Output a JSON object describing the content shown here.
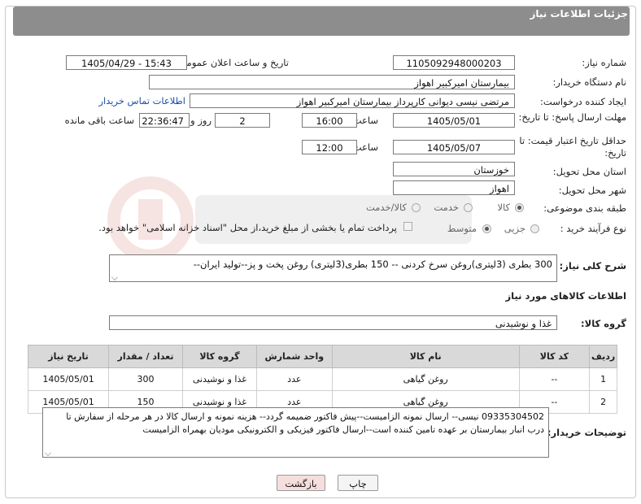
{
  "header": {
    "title": "جزئیات اطلاعات نیاز"
  },
  "fields": {
    "need_number_label": "شماره نیاز:",
    "need_number": "1105092948000203",
    "announce_label": "تاریخ و ساعت اعلان عمومی:",
    "announce_value": "1405/04/29 - 15:43",
    "buyer_org_label": "نام دستگاه خریدار:",
    "buyer_org": "بیمارستان امیرکبیر اهواز",
    "creator_label": "ایجاد کننده درخواست:",
    "creator": "مرتضی نیسی دیوانی کارپرداز بیمارستان امیرکبیر اهواز",
    "contact_link": "اطلاعات تماس خریدار",
    "reply_deadline_label": "مهلت ارسال پاسخ: تا تاریخ:",
    "reply_date": "1405/05/01",
    "time_label": "ساعت",
    "reply_time": "16:00",
    "days_value": "2",
    "days_label": "روز و",
    "remaining_time": "22:36:47",
    "remaining_label": "ساعت باقی مانده",
    "price_deadline_label": "حداقل تاریخ اعتبار قیمت: تا تاریخ:",
    "price_date": "1405/05/07",
    "price_time_label": "ساعت",
    "price_time": "12:00",
    "province_label": "استان محل تحویل:",
    "province": "خوزستان",
    "city_label": "شهر محل تحویل:",
    "city": "اهواز",
    "category_label": "طبقه بندی موضوعی:",
    "category_options": [
      "کالا",
      "خدمت",
      "کالا/خدمت"
    ],
    "process_label": "نوع فرآیند خرید :",
    "process_options": [
      "جزیی",
      "متوسط"
    ],
    "payment_note": "پرداخت تمام یا بخشی از مبلغ خرید،از محل \"اسناد خزانه اسلامی\" خواهد بود."
  },
  "description": {
    "label": "شرح کلی نیاز:",
    "text": "300 بطری (3لیتری)روغن سرخ کردنی -- 150 بطری(3لیتری) روغن پخت و پز--تولید ایران--"
  },
  "goods": {
    "section_title": "اطلاعات کالاهای مورد نیاز",
    "group_label": "گروه کالا:",
    "group_value": "غذا و نوشیدنی",
    "columns": [
      "ردیف",
      "کد کالا",
      "نام کالا",
      "واحد شمارش",
      "گروه کالا",
      "تعداد / مقدار",
      "تاریخ نیاز"
    ],
    "rows": [
      [
        "1",
        "--",
        "روغن گیاهی",
        "عدد",
        "غذا و نوشیدنی",
        "300",
        "1405/05/01"
      ],
      [
        "2",
        "--",
        "روغن گیاهی",
        "عدد",
        "غذا و نوشیدنی",
        "150",
        "1405/05/01"
      ]
    ]
  },
  "buyer_notes": {
    "label": "توضیحات خریدار:",
    "text": "09335304502 نیسی-- ارسال نمونه الزامیست--پیش فاکتور ضمیمه گردد-- هزینه نمونه و ارسال کالا در هر مرحله از سفارش تا درب انبار بیمارستان بر عهده تامین کننده است--ارسال فاکتور فیزیکی و الکترونیکی مودیان بهمراه الزامیست"
  },
  "buttons": {
    "print": "چاپ",
    "back": "بازگشت"
  },
  "colors": {
    "header_bg": "#8d8d8d",
    "link": "#1c4fa8",
    "back_button_bg": "#f7dede",
    "table_header_bg": "#d9d9d9"
  }
}
